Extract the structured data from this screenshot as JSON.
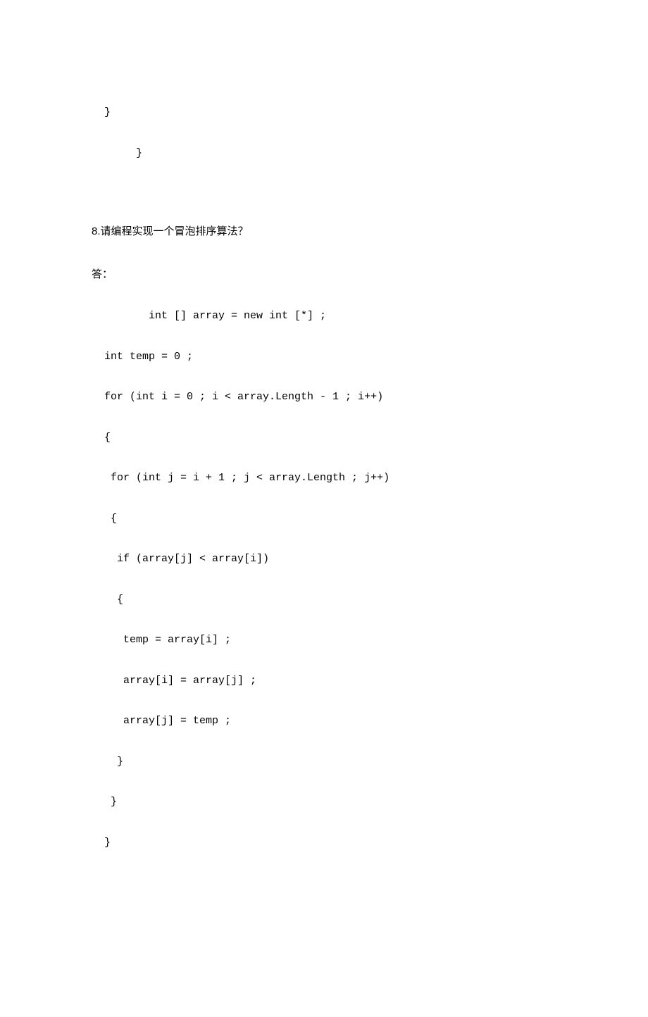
{
  "top": {
    "brace1": "  }",
    "brace2": "       }"
  },
  "q8": {
    "question": "8.请编程实现一个冒泡排序算法？",
    "answer_label": "答：",
    "code": {
      "l1": "         int [] array = new int [*] ;",
      "l2": "  int temp = 0 ;",
      "l3": "  for (int i = 0 ; i < array.Length - 1 ; i++)",
      "l4": "  {",
      "l5": "   for (int j = i + 1 ; j < array.Length ; j++)",
      "l6": "   {",
      "l7": "    if (array[j] < array[i])",
      "l8": "    {",
      "l9": "     temp = array[i] ;",
      "l10": "     array[i] = array[j] ;",
      "l11": "     array[j] = temp ;",
      "l12": "    }",
      "l13": "   }",
      "l14": "  }"
    }
  }
}
